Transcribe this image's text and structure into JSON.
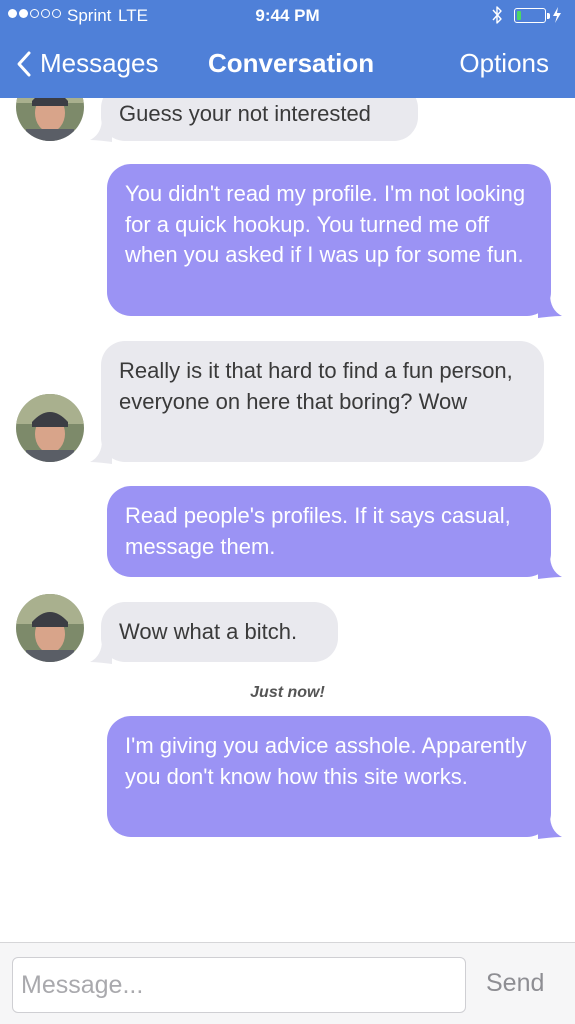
{
  "status_bar": {
    "carrier": "Sprint",
    "network": "LTE",
    "time": "9:44 PM",
    "icons": [
      "signal-dots",
      "bluetooth-icon",
      "battery-icon",
      "charging-bolt-icon"
    ],
    "battery_level": 0.15,
    "battery_color": "#4cd964"
  },
  "nav": {
    "back_label": "Messages",
    "back_icon": "chevron-left-icon",
    "title": "Conversation",
    "options_label": "Options"
  },
  "colors": {
    "header": "#4f80d8",
    "incoming_bubble": "#e9e9ee",
    "outgoing_bubble": "#9b93f4"
  },
  "messages": [
    {
      "direction": "incoming",
      "text": "Guess your not interested"
    },
    {
      "direction": "outgoing",
      "text": "You didn't read my profile. I'm not looking for a quick hookup. You turned me off when you asked if I was up for some fun."
    },
    {
      "direction": "incoming",
      "text": "Really is it that hard to find a fun person, everyone on here that boring? Wow"
    },
    {
      "direction": "outgoing",
      "text": "Read people's profiles. If it says casual, message them."
    },
    {
      "direction": "incoming",
      "text": "Wow what a bitch."
    },
    {
      "direction": "outgoing",
      "text": "I'm giving you advice asshole. Apparently you don't know how this site works."
    }
  ],
  "timestamp": "Just now!",
  "composer": {
    "placeholder": "Message...",
    "value": "",
    "send_label": "Send"
  }
}
